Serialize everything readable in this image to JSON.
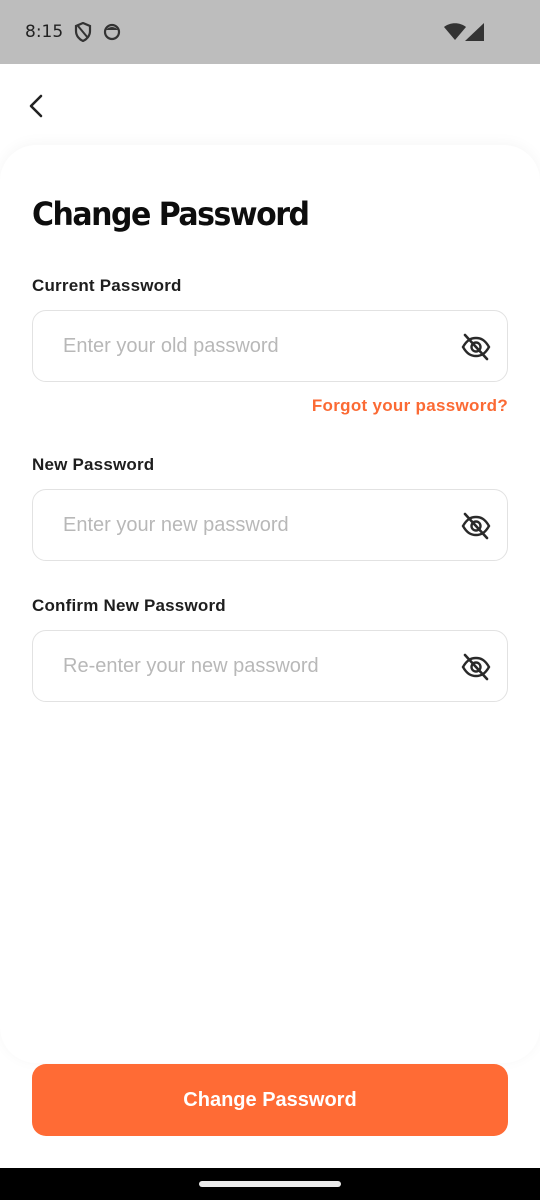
{
  "status_bar": {
    "time": "8:15",
    "icons": [
      "shield-icon",
      "face-icon",
      "wifi-icon",
      "signal-icon"
    ]
  },
  "header": {
    "back_icon": "chevron-left-icon"
  },
  "page": {
    "title": "Change Password"
  },
  "form": {
    "current": {
      "label": "Current Password",
      "placeholder": "Enter your old password",
      "value": "",
      "toggle_icon": "eye-off-icon"
    },
    "forgot_link": "Forgot your password?",
    "new": {
      "label": "New Password",
      "placeholder": "Enter your new password",
      "value": "",
      "toggle_icon": "eye-off-icon"
    },
    "confirm": {
      "label": "Confirm New Password",
      "placeholder": "Re-enter your new password",
      "value": "",
      "toggle_icon": "eye-off-icon"
    }
  },
  "submit": {
    "label": "Change Password"
  },
  "colors": {
    "accent": "#ff6b35",
    "link": "#fb6a34",
    "status_bar": "#bdbdbd",
    "placeholder": "#b8b8b8"
  }
}
